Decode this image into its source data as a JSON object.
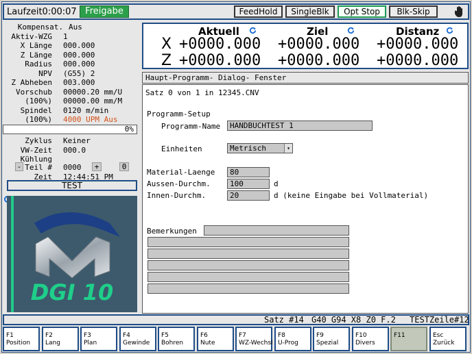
{
  "topbar": {
    "runtime": "Laufzeit0:00:07",
    "freigabe": "Freigabe",
    "buttons": [
      "FeedHold",
      "SingleBlk",
      "Opt Stop",
      "Blk-Skip"
    ]
  },
  "left": {
    "rows": [
      {
        "label": "Kompensat.",
        "value": "Aus"
      },
      {
        "label": "Aktiv-WZG",
        "value": "1"
      },
      {
        "label": "X Länge",
        "value": "000.000"
      },
      {
        "label": "Z Länge",
        "value": "000.000"
      },
      {
        "label": "Radius",
        "value": "000.000"
      },
      {
        "label": "NPV",
        "value": "(G55) 2"
      },
      {
        "label": "Z Abheben",
        "value": "003.000"
      },
      {
        "label": "Vorschub",
        "value": "00000.20 mm/U"
      },
      {
        "label": "(100%)",
        "value": "00000.00 mm/M"
      },
      {
        "label": "Spindel",
        "value": "0120 m/min"
      },
      {
        "label": "(100%)",
        "value": "4000 UPM Aus"
      }
    ],
    "progress_label": "0%",
    "progress_value": 0,
    "rows2": [
      {
        "label": "Zyklus",
        "value": "Keiner"
      },
      {
        "label": "VW-Zeit",
        "value": "000.0"
      },
      {
        "label": "Kühlung",
        "value": ""
      }
    ],
    "teil": {
      "minus": "-",
      "label": "Teil #",
      "value": "0000",
      "plus": "+",
      "count": "0"
    },
    "zeit": {
      "label": "Zeit",
      "value": "12:44:51 PM"
    },
    "test_label": "TEST",
    "logo_text": "DGI 10"
  },
  "axes": {
    "headers": [
      "Aktuell",
      "Ziel",
      "Distanz"
    ],
    "rows": [
      {
        "axis": "X",
        "aktuell": "+0000.000",
        "ziel": "+0000.000",
        "distanz": "+0000.000"
      },
      {
        "axis": "Z",
        "aktuell": "+0000.000",
        "ziel": "+0000.000",
        "distanz": "+0000.000"
      }
    ]
  },
  "main": {
    "header": "Haupt-Programm-  Dialog- Fenster",
    "satz_line": "Satz 0 von 1 in 12345.CNV",
    "setup_title": "Programm-Setup",
    "name_label": "Programm-Name",
    "name_value": "HANDBUCHTEST 1",
    "einheiten_label": "Einheiten",
    "einheiten_value": "Metrisch",
    "material_label": "Material-Laenge",
    "material_value": "80",
    "aussen_label": "Aussen-Durchm.",
    "aussen_value": "100",
    "aussen_unit": "d",
    "innen_label": "Innen-Durchm.",
    "innen_value": "20",
    "innen_unit": "d (keine Eingabe bei Vollmaterial)",
    "bemerkungen_label": "Bemerkungen"
  },
  "status": {
    "satz": "Satz #14",
    "codes": "G40 G94 X8 Z0 F.2",
    "zeile": "TESTZeile#12"
  },
  "fkeys": [
    {
      "key": "F1",
      "label": "Position"
    },
    {
      "key": "F2",
      "label": "Lang"
    },
    {
      "key": "F3",
      "label": "Plan"
    },
    {
      "key": "F4",
      "label": "Gewinde"
    },
    {
      "key": "F5",
      "label": "Bohren"
    },
    {
      "key": "F6",
      "label": "Nute"
    },
    {
      "key": "F7",
      "label": "WZ-Wechsl"
    },
    {
      "key": "F8",
      "label": "U-Prog"
    },
    {
      "key": "F9",
      "label": "Spezial"
    },
    {
      "key": "F10",
      "label": "Divers"
    },
    {
      "key": "F11",
      "label": ""
    },
    {
      "key": "Esc",
      "label": "Zurück"
    }
  ],
  "colors": {
    "frame": "#1e4c86",
    "freigabe": "#2c9f4a",
    "alert": "#d4521a",
    "logo_bg": "#3c5a6c",
    "logo_text": "#1fcf8a"
  }
}
